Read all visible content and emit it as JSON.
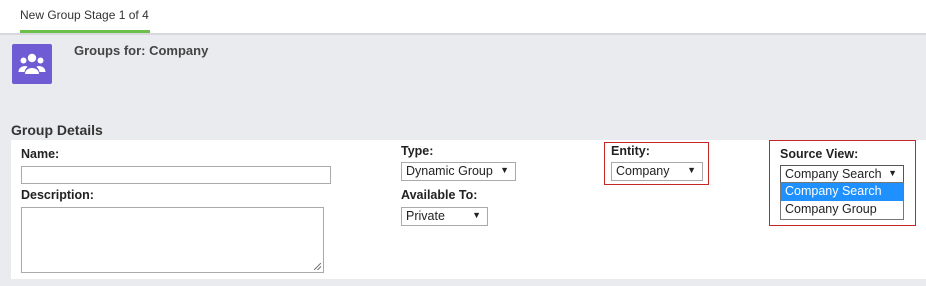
{
  "tabs": [
    {
      "label": "New Group Stage 1 of 4"
    }
  ],
  "header": {
    "icon": "group-icon",
    "title": "Groups for: Company"
  },
  "section": {
    "title": "Group Details"
  },
  "form": {
    "name_label": "Name:",
    "name_value": "",
    "description_label": "Description:",
    "description_value": "",
    "type_label": "Type:",
    "type_value": "Dynamic Group",
    "available_label": "Available To:",
    "available_value": "Private",
    "entity_label": "Entity:",
    "entity_value": "Company",
    "source_label": "Source View:",
    "source_value": "Company Search",
    "source_options": [
      "Company Search",
      "Company Group"
    ],
    "source_selected_option": "Company Search"
  },
  "colors": {
    "accent_tab": "#6cc04a",
    "icon_bg": "#6f5bd4",
    "highlight_border": "#c62828",
    "option_selected": "#1e90ff"
  }
}
